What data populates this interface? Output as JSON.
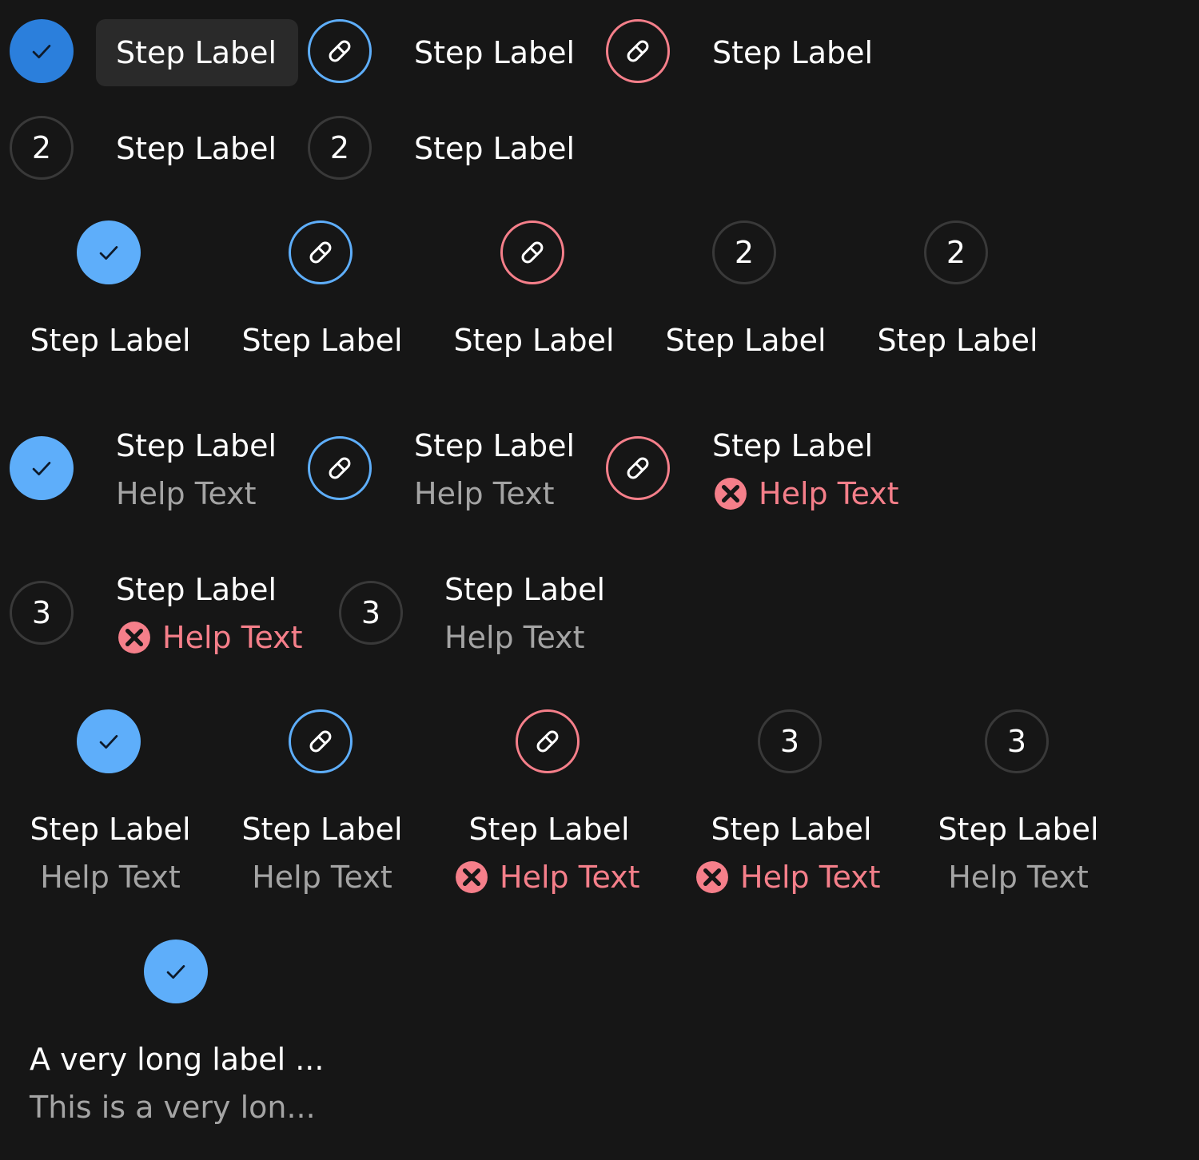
{
  "labels": {
    "step": "Step Label",
    "help": "Help Text",
    "long_label": "A very long label ...",
    "long_help": "This is a very lon...",
    "num2": "2",
    "num3": "3"
  },
  "colors": {
    "background": "#161616",
    "complete_dark": "#2b7fdc",
    "complete": "#5eaefa",
    "editing_blue": "#5eaefa",
    "error_red": "#f57f8a",
    "number_border": "#393939",
    "help_text": "#a4a4a4",
    "hover_background": "#2a2a2a"
  },
  "icons": {
    "complete": "checkmark-icon",
    "editing": "pencil-icon",
    "error": "error-x-icon"
  }
}
